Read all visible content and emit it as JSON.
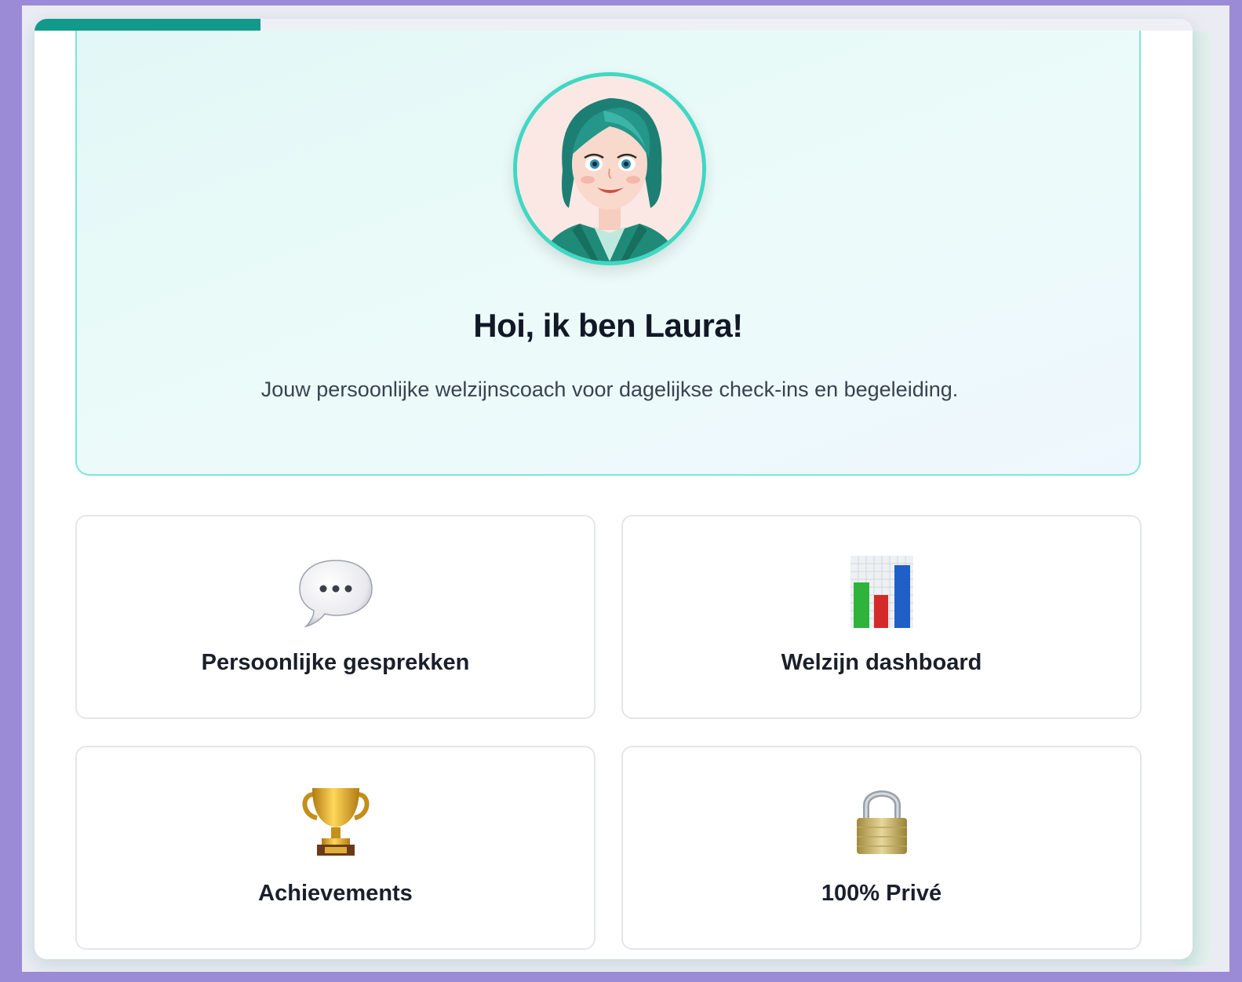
{
  "onboarding": {
    "progress_fraction": 0.195,
    "progress_color": "#11998a"
  },
  "hero": {
    "avatar_icon": "coach-avatar-illustration",
    "title": "Hoi, ik ben Laura!",
    "subtitle": "Jouw persoonlijke welzijnscoach voor dagelijkse check-ins en begeleiding."
  },
  "features": [
    {
      "icon": "speech-bubble-icon",
      "label": "Persoonlijke gesprekken"
    },
    {
      "icon": "bar-chart-icon",
      "label": "Welzijn dashboard"
    },
    {
      "icon": "trophy-icon",
      "label": "Achievements"
    },
    {
      "icon": "padlock-icon",
      "label": "100% Privé"
    }
  ],
  "colors": {
    "frame": "#9b8bd6",
    "accent": "#3ed8c4",
    "hero_border": "#7ee6d6"
  }
}
